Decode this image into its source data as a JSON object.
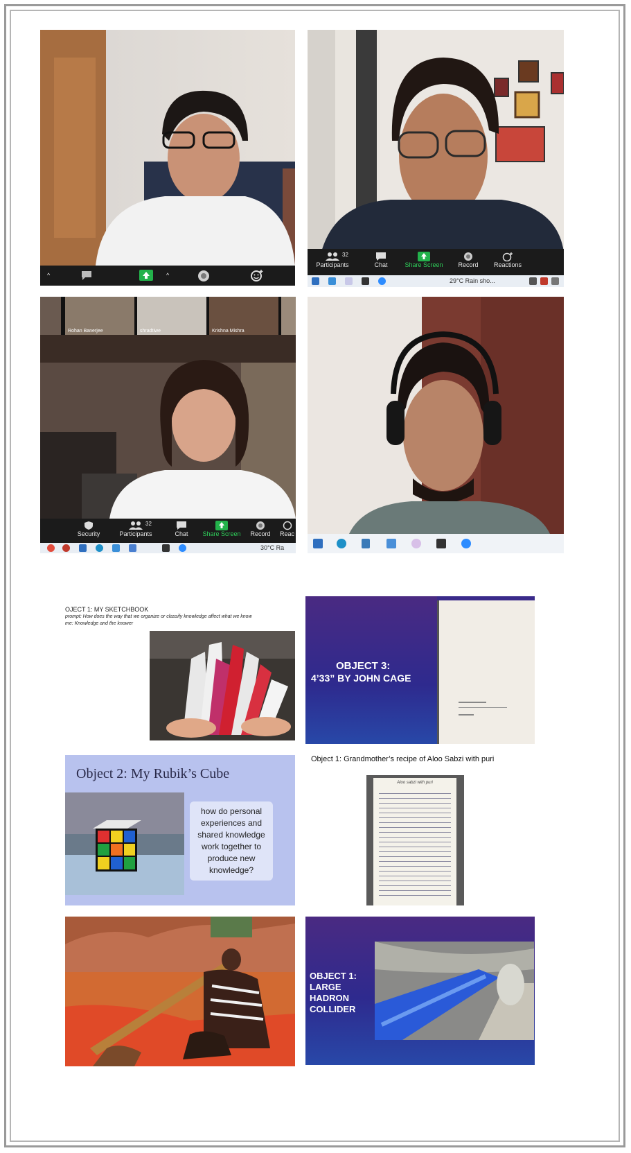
{
  "zoom_tile1": {
    "toolbar": {
      "caret": "^"
    }
  },
  "zoom_tile2": {
    "toolbar": {
      "participants_count": "32",
      "participants": "Participants",
      "chat": "Chat",
      "share_screen": "Share Screen",
      "record": "Record",
      "reactions": "Reactions"
    },
    "taskbar": {
      "weather": "29°C Rain sho..."
    }
  },
  "zoom_tile3": {
    "thumbnails": [
      "Rohan Banerjee",
      "shradtiwe",
      "Krishna Mishra"
    ],
    "toolbar": {
      "security": "Security",
      "participants_count": "32",
      "participants": "Participants",
      "chat": "Chat",
      "share_screen": "Share Screen",
      "record": "Record",
      "reactions": "Reac"
    },
    "taskbar": {
      "weather": "30°C Ra"
    }
  },
  "slides": {
    "sketchbook": {
      "title": "OJECT 1: MY SKETCHBOOK",
      "prompt": "prompt: How does the way that we organize or classify knowledge affect what we know",
      "theme": "me: Knowledge and the knower"
    },
    "cage": {
      "line1": "OBJECT 3:",
      "line2": "4’33” BY JOHN CAGE"
    },
    "rubik": {
      "title": "Object 2: My Rubik’s Cube",
      "question": "how do personal experiences and shared knowledge work together to produce new knowledge?"
    },
    "recipe": {
      "title": "Object 1: Grandmother’s recipe of Aloo Sabzi with puri",
      "note_heading": "Aloo sabzi with puri"
    },
    "hadron": {
      "lines": [
        "OBJECT 1:",
        "LARGE",
        "HADRON",
        "COLLIDER"
      ]
    }
  },
  "colors": {
    "zoom_bar": "#1b1b1b",
    "share_green": "#23b24b",
    "slide_purple": "#3a2a8a",
    "rubik_lavender": "#b8c2ee"
  }
}
